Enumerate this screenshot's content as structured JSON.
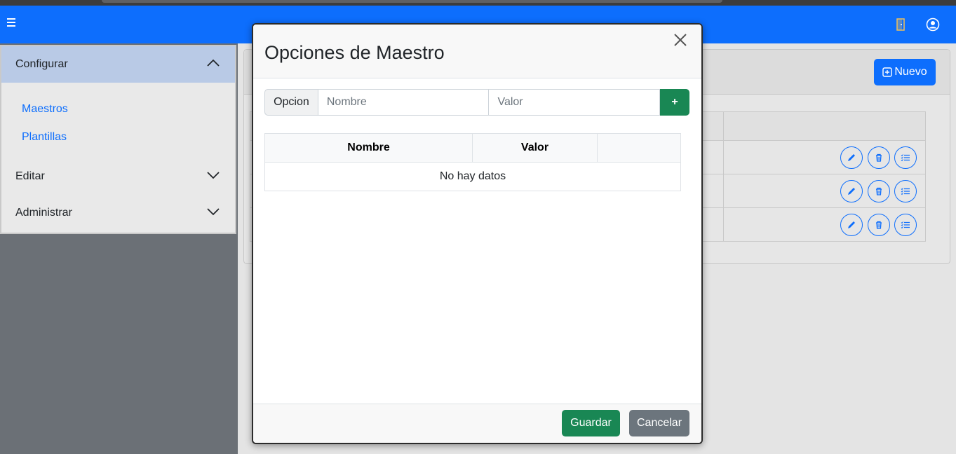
{
  "sidebar": {
    "sections": [
      {
        "label": "Configurar",
        "expanded": true,
        "items": [
          "Maestros",
          "Plantillas"
        ]
      },
      {
        "label": "Editar",
        "expanded": false
      },
      {
        "label": "Administrar",
        "expanded": false
      }
    ]
  },
  "toolbar": {
    "new_label": "Nuevo"
  },
  "modal": {
    "title": "Opciones de Maestro",
    "input_group": {
      "label": "Opcion",
      "name_placeholder": "Nombre",
      "value_placeholder": "Valor",
      "add_label": "+"
    },
    "table": {
      "headers": [
        "Nombre",
        "Valor",
        ""
      ],
      "empty_text": "No hay datos"
    },
    "save_label": "Guardar",
    "cancel_label": "Cancelar"
  },
  "colors": {
    "primary": "#0d6efd",
    "success": "#198754",
    "secondary": "#6c757d",
    "sidebar_active": "#b9cae6"
  }
}
